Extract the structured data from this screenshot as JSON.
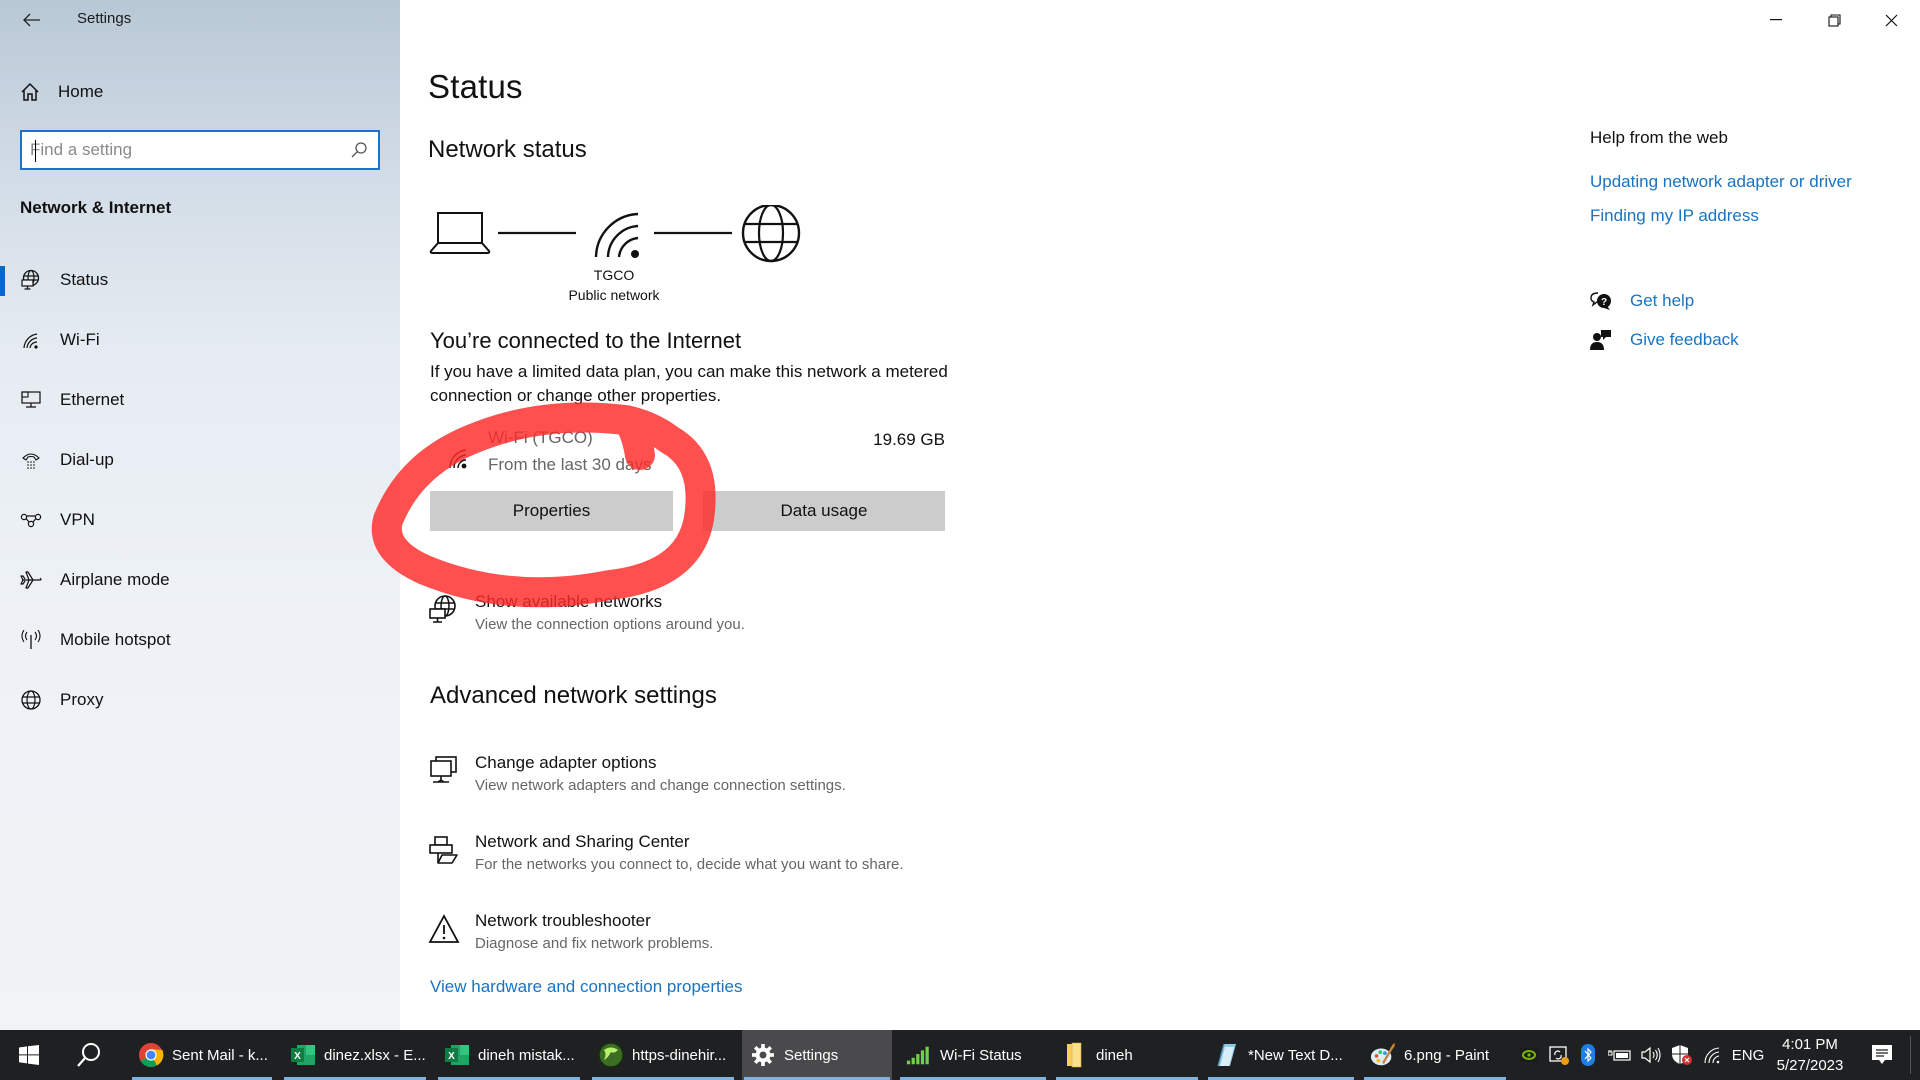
{
  "window": {
    "title": "Settings",
    "controls": {
      "minimize": "minimize-icon",
      "restore": "restore-icon",
      "close": "close-icon"
    }
  },
  "sidebar": {
    "home_label": "Home",
    "search_placeholder": "Find a setting",
    "search_value": "",
    "section_title": "Network & Internet",
    "items": [
      {
        "label": "Status",
        "icon": "network-status-icon",
        "active": true
      },
      {
        "label": "Wi-Fi",
        "icon": "wifi-icon",
        "active": false
      },
      {
        "label": "Ethernet",
        "icon": "ethernet-icon",
        "active": false
      },
      {
        "label": "Dial-up",
        "icon": "dial-up-icon",
        "active": false
      },
      {
        "label": "VPN",
        "icon": "vpn-icon",
        "active": false
      },
      {
        "label": "Airplane mode",
        "icon": "airplane-icon",
        "active": false
      },
      {
        "label": "Mobile hotspot",
        "icon": "hotspot-icon",
        "active": false
      },
      {
        "label": "Proxy",
        "icon": "globe-icon",
        "active": false
      }
    ]
  },
  "main": {
    "page_title": "Status",
    "network_status_heading": "Network status",
    "diagram": {
      "network_name": "TGCO",
      "network_type": "Public network"
    },
    "connected_heading": "You’re connected to the Internet",
    "connected_description": "If you have a limited data plan, you can make this network a metered connection or change other properties.",
    "connection": {
      "name": "Wi-Fi (TGCO)",
      "period": "From the last 30 days",
      "usage": "19.69 GB"
    },
    "buttons": {
      "properties": "Properties",
      "data_usage": "Data usage"
    },
    "show_networks": {
      "title": "Show available networks",
      "subtitle": "View the connection options around you."
    },
    "advanced_heading": "Advanced network settings",
    "advanced_items": [
      {
        "title": "Change adapter options",
        "subtitle": "View network adapters and change connection settings.",
        "icon": "adapter-icon"
      },
      {
        "title": "Network and Sharing Center",
        "subtitle": "For the networks you connect to, decide what you want to share.",
        "icon": "sharing-center-icon"
      },
      {
        "title": "Network troubleshooter",
        "subtitle": "Diagnose and fix network problems.",
        "icon": "warning-icon"
      }
    ],
    "hardware_link": "View hardware and connection properties"
  },
  "help": {
    "heading": "Help from the web",
    "links": [
      "Updating network adapter or driver",
      "Finding my IP address"
    ],
    "get_help": "Get help",
    "give_feedback": "Give feedback"
  },
  "annotation": {
    "color": "#ff2a2a",
    "target": "Properties"
  },
  "taskbar": {
    "apps": [
      {
        "label": "Sent Mail - k...",
        "icon": "chrome-icon",
        "active": false
      },
      {
        "label": "dinez.xlsx - E...",
        "icon": "excel-icon",
        "active": false
      },
      {
        "label": "dineh mistak...",
        "icon": "excel-icon",
        "active": false
      },
      {
        "label": "https-dinehir...",
        "icon": "app-icon",
        "active": false
      },
      {
        "label": "Settings",
        "icon": "gear-icon",
        "active": true
      },
      {
        "label": "Wi-Fi Status",
        "icon": "signal-bars-icon",
        "active": false
      },
      {
        "label": "dineh",
        "icon": "folder-icon",
        "active": false
      },
      {
        "label": "*New Text D...",
        "icon": "notepad-icon",
        "active": false
      },
      {
        "label": "6.png - Paint",
        "icon": "paint-icon",
        "active": false
      }
    ],
    "tray": {
      "language": "ENG",
      "time": "4:01 PM",
      "date": "5/27/2023"
    }
  }
}
